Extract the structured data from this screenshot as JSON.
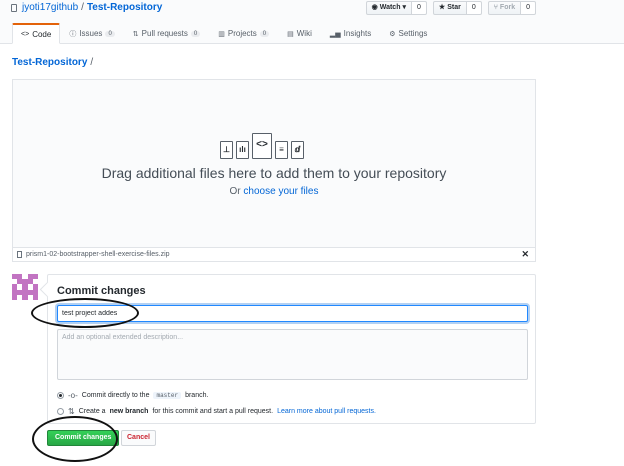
{
  "header": {
    "owner": "jyoti17github",
    "separator": "/",
    "repo": "Test-Repository",
    "watch": {
      "label": "Watch",
      "icon": "eye-icon",
      "count": "0"
    },
    "star": {
      "label": "Star",
      "icon": "star-icon",
      "count": "0"
    },
    "fork": {
      "label": "Fork",
      "icon": "fork-icon",
      "count": "0"
    }
  },
  "tabs": [
    {
      "label": "Code",
      "icon": "code-icon",
      "selected": true
    },
    {
      "label": "Issues",
      "icon": "issue-icon",
      "count": "0"
    },
    {
      "label": "Pull requests",
      "icon": "pull-request-icon",
      "count": "0"
    },
    {
      "label": "Projects",
      "icon": "project-icon",
      "count": "0"
    },
    {
      "label": "Wiki",
      "icon": "book-icon"
    },
    {
      "label": "Insights",
      "icon": "graph-icon"
    },
    {
      "label": "Settings",
      "icon": "gear-icon"
    }
  ],
  "breadcrumb": {
    "repo": "Test-Repository",
    "slash": "/"
  },
  "dropzone": {
    "title": "Drag additional files here to add them to your repository",
    "sub_prefix": "Or",
    "sub_link": "choose your files"
  },
  "uploaded_file": {
    "name": "prism1-02-bootstrapper-shell-exercise-files.zip",
    "remove": "✕"
  },
  "commit": {
    "title": "Commit changes",
    "summary_value": "test project addes",
    "description_placeholder": "Add an optional extended description...",
    "option_direct": {
      "prefix": "Commit directly to the",
      "branch": "master",
      "suffix": "branch."
    },
    "option_new": {
      "prefix": "Create a",
      "bold": "new branch",
      "suffix": "for this commit and start a pull request.",
      "link": "Learn more about pull requests."
    },
    "submit_label": "Commit changes",
    "cancel_label": "Cancel"
  },
  "colors": {
    "accent": "#e36209",
    "link": "#0366d6",
    "primary": "#28a745",
    "danger": "#cb2431",
    "avatar": "#c274c2"
  }
}
